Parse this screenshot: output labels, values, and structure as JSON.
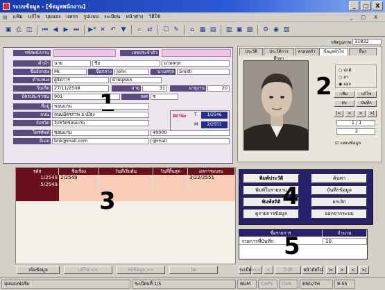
{
  "window": {
    "title": "ระบบข้อมูล - [ข้อมูลพนักงาน]",
    "controls": [
      "_",
      "□",
      "X"
    ],
    "child_controls": [
      "_",
      "□",
      "X"
    ]
  },
  "menu": [
    "แฟ้ม",
    "แก้ไข",
    "มุมมอง",
    "แทรก",
    "รูปแบบ",
    "ระเบียน",
    "หน้าต่าง",
    "วิธีใช้"
  ],
  "toolbar_icons": [
    "save-icon",
    "print-icon",
    "preview-icon",
    "first-record-icon",
    "prev-record-icon",
    "next-record-icon",
    "last-record-icon",
    "new-record-icon",
    "delete-icon",
    "undo-icon",
    "filter-icon",
    "find-icon",
    "replace-icon",
    "sort-icon",
    "design-icon",
    "props-icon",
    "form-icon",
    "code-icon",
    "window-icon",
    "help-icon",
    "db-icon",
    "exit-icon"
  ],
  "panel1": {
    "rows": [
      {
        "label": "รหัสพนักงาน",
        "value": "",
        "label2": "เลขประจำตัว",
        "value2": ""
      },
      {
        "label": "คำนำ",
        "value": "นาย",
        "value_b": "ชื่อ",
        "value_c": "นามสกุล"
      },
      {
        "label": "ชื่ออังกฤษ",
        "value": "Mr.",
        "label2": "ชื่อกลาง",
        "value2": "John",
        "label3": "นามสกุล",
        "value3": "Smith"
      },
      {
        "label": "ตำแหน่ง",
        "value": "ผู้จัดการ",
        "value_b": "ฝ่ายบุคคล"
      },
      {
        "label": "วันเกิด",
        "value": "27/11/2508",
        "label2": "อายุ",
        "value2": "31",
        "label3": "อายุงาน",
        "value3": "20"
      },
      {
        "label": "บัตรประชาชน",
        "value": "901",
        "label2": "เพศ",
        "value2": "ช"
      },
      {
        "label": "ที่อยู่",
        "value": "ขอนแก่น"
      },
      {
        "label": "ถนน",
        "value": "ถนนมิตรภาพ อ.เมือง"
      },
      {
        "label": "จังหวัด",
        "value": "จังหวัดขอนแก่น"
      },
      {
        "label": "โทรศัพท์",
        "value": "ขอนแก่น",
        "value_b": "40000"
      },
      {
        "label": "อีเมล",
        "value": "bnk@mail.com",
        "value_b": "@mail"
      }
    ],
    "side_box": {
      "label": "สถานะ",
      "tag1": "T",
      "val1": "1/2546",
      "tag2": "M",
      "val2": "2/2551"
    },
    "number": "1"
  },
  "photo_panel": {
    "code_label": "รหัสรูปภาพ",
    "code_value": "31832",
    "tabs": [
      "ประวัติ",
      "ประวัติการศึกษา",
      "ครอบครัว",
      "ข้อมูลทั่วไป",
      "อื่นๆ"
    ],
    "radios": [
      "ปกติ",
      "ลา",
      "ออก"
    ],
    "buttons": [
      [
        "เพิ่ม",
        "แก้ไข"
      ],
      [
        "ลบ",
        "บันทึก"
      ]
    ],
    "nav_small": [
      "|<",
      "<",
      ">",
      ">|"
    ],
    "counter": "1 / 1",
    "counter2": "2",
    "check_label": "แสดงข้อมูล",
    "number": "2"
  },
  "panel3": {
    "headers": [
      "รหัส",
      "ชื่อเรื่อง",
      "วันที่เริ่มต้น",
      "วันที่สิ้นสุด",
      "ผลการอบรม"
    ],
    "rows": [
      [
        "1/2549",
        "2/2549",
        "",
        "",
        "3/22/2551"
      ],
      [
        "5/2549",
        "",
        "",
        "",
        ""
      ]
    ],
    "number": "3"
  },
  "panel4": {
    "buttons": [
      [
        "พิมพ์ประวัติ",
        "ค้นหา"
      ],
      [
        "พิมพ์ใบรายงาน",
        "บันทึกข้อมูล"
      ],
      [
        "พิมพ์สถิติ",
        "ยกเลิก"
      ],
      [
        "ดูรายการข้อมูล",
        "ออกจากระบบ"
      ]
    ],
    "number": "4"
  },
  "panel5": {
    "headers": [
      "ชื่อรายการ",
      "จำนวน"
    ],
    "rows": [
      [
        "รายการที่บันทึก",
        "10"
      ]
    ],
    "number": "5"
  },
  "navbar": {
    "left_buttons": [
      "เพิ่มข้อมูล",
      "แก้ไข <<",
      "ลบข้อมูล >>",
      "ปิด"
    ],
    "right_label": "ระเบียน",
    "right_buttons": [
      "<<",
      "<",
      "ไปที่",
      "หน้าถัดไป",
      "|<",
      ">",
      "<",
      ">|"
    ]
  },
  "status": {
    "mode": "มุมมองฟอร์ม",
    "record": "ระเบียนที่ 1/5",
    "caps": "NUM",
    "ins": "CAPS",
    "ovr": "OVR",
    "lang": "ENG/TH",
    "time": "8:55"
  }
}
